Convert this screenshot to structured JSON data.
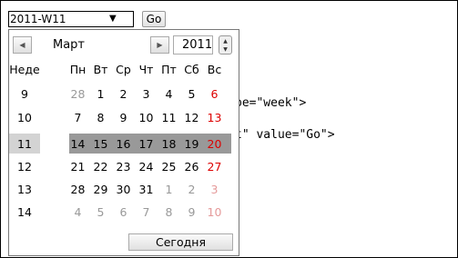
{
  "code_lines": [
    "pe=\"week\">",
    "t\" value=\"Go\">"
  ],
  "week_input": {
    "value": "2011-W11",
    "arrow": "▼"
  },
  "go_button": "Go",
  "calendar": {
    "month": "Март",
    "year": "2011",
    "week_header": "Неде",
    "day_headers": [
      "Пн",
      "Вт",
      "Ср",
      "Чт",
      "Пт",
      "Сб",
      "Вс"
    ],
    "weeks": [
      {
        "num": "9",
        "days": [
          {
            "d": "28",
            "c": "grey"
          },
          {
            "d": "1"
          },
          {
            "d": "2"
          },
          {
            "d": "3"
          },
          {
            "d": "4"
          },
          {
            "d": "5"
          },
          {
            "d": "6",
            "c": "red"
          }
        ]
      },
      {
        "num": "10",
        "days": [
          {
            "d": "7"
          },
          {
            "d": "8"
          },
          {
            "d": "9"
          },
          {
            "d": "10"
          },
          {
            "d": "11"
          },
          {
            "d": "12"
          },
          {
            "d": "13",
            "c": "red"
          }
        ]
      },
      {
        "num": "11",
        "selected": true,
        "days": [
          {
            "d": "14"
          },
          {
            "d": "15"
          },
          {
            "d": "16"
          },
          {
            "d": "17"
          },
          {
            "d": "18"
          },
          {
            "d": "19"
          },
          {
            "d": "20",
            "c": "red"
          }
        ]
      },
      {
        "num": "12",
        "days": [
          {
            "d": "21"
          },
          {
            "d": "22"
          },
          {
            "d": "23"
          },
          {
            "d": "24"
          },
          {
            "d": "25"
          },
          {
            "d": "26"
          },
          {
            "d": "27",
            "c": "red"
          }
        ]
      },
      {
        "num": "13",
        "days": [
          {
            "d": "28"
          },
          {
            "d": "29"
          },
          {
            "d": "30"
          },
          {
            "d": "31"
          },
          {
            "d": "1",
            "c": "grey"
          },
          {
            "d": "2",
            "c": "grey"
          },
          {
            "d": "3",
            "c": "greyred"
          }
        ]
      },
      {
        "num": "14",
        "days": [
          {
            "d": "4",
            "c": "grey"
          },
          {
            "d": "5",
            "c": "grey"
          },
          {
            "d": "6",
            "c": "grey"
          },
          {
            "d": "7",
            "c": "grey"
          },
          {
            "d": "8",
            "c": "grey"
          },
          {
            "d": "9",
            "c": "grey"
          },
          {
            "d": "10",
            "c": "greyred"
          }
        ]
      }
    ],
    "today_button": "Сегодня"
  }
}
